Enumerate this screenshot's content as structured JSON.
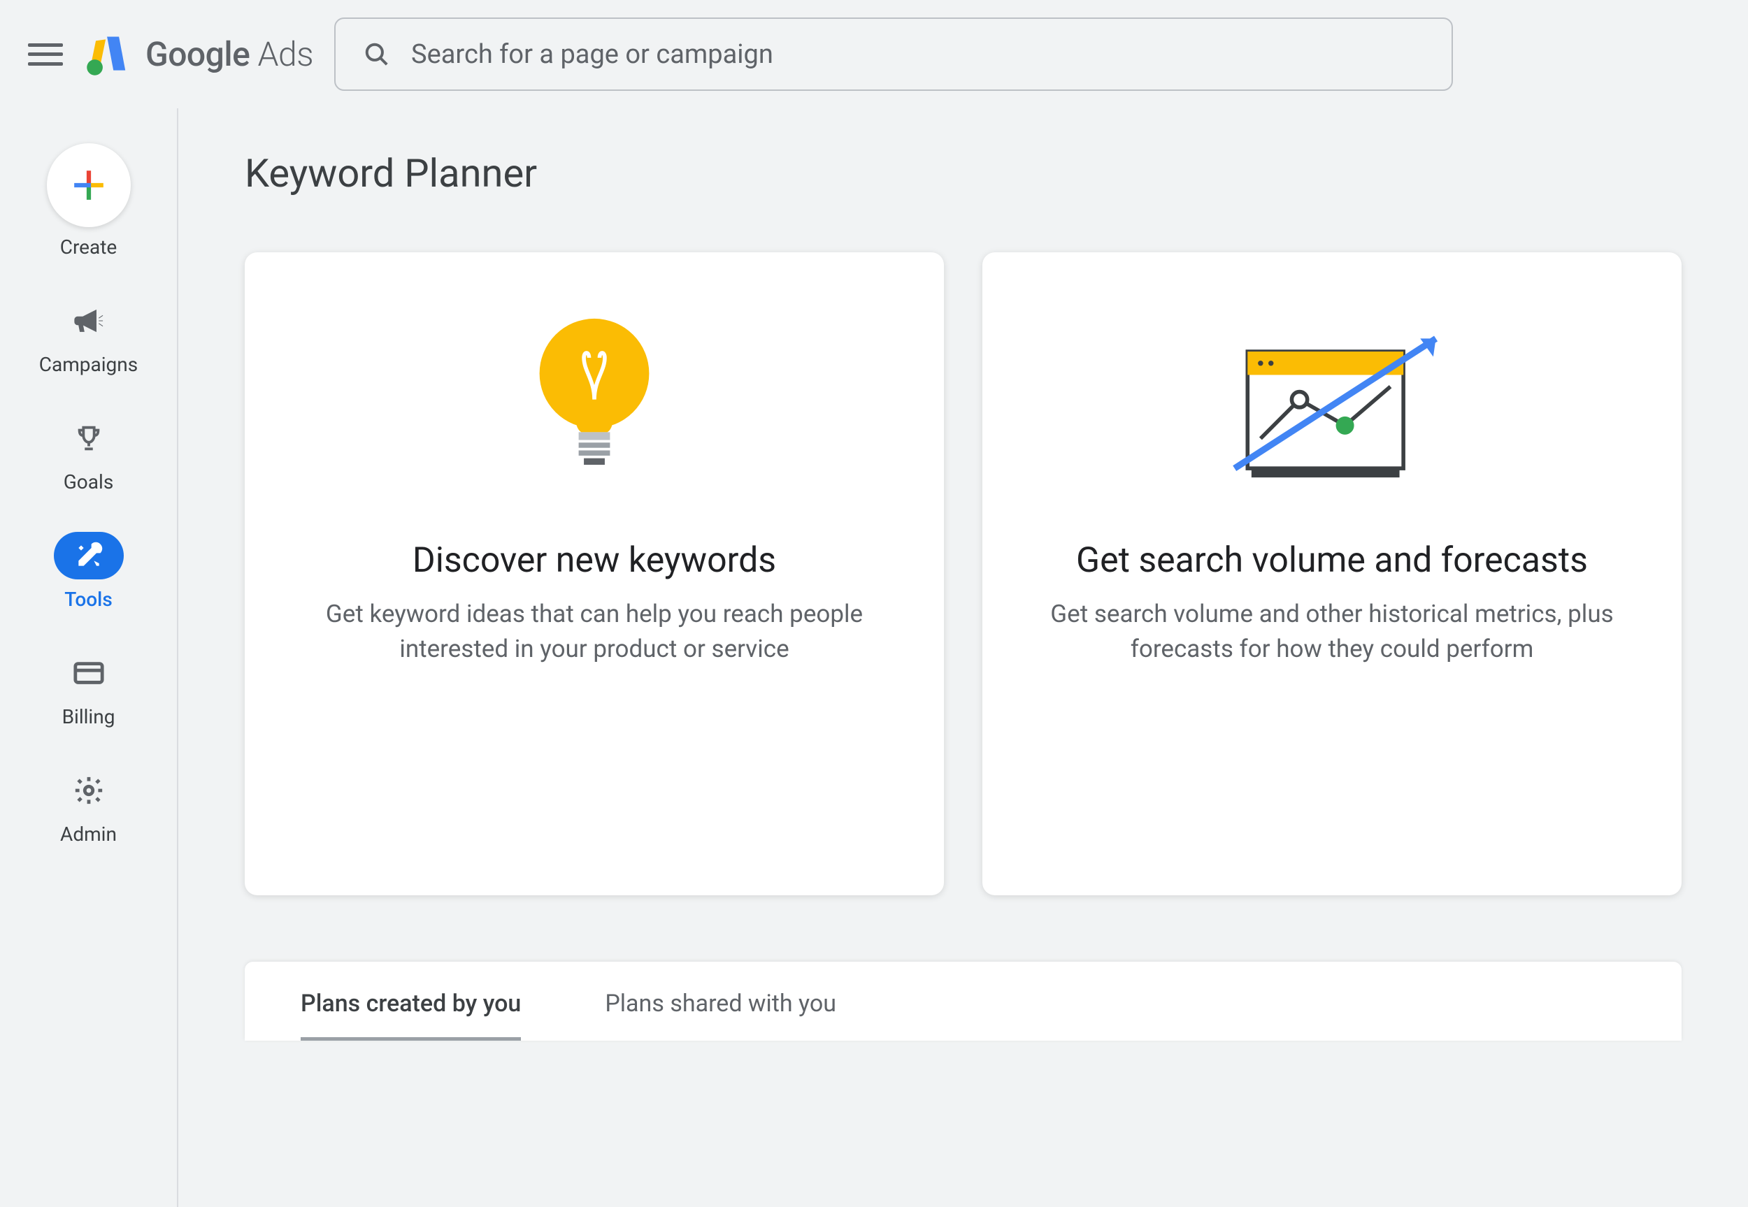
{
  "header": {
    "logo_text_bold": "Google",
    "logo_text_light": " Ads",
    "search_placeholder": "Search for a page or campaign"
  },
  "sidebar": {
    "items": [
      {
        "label": "Create",
        "icon": "plus-multicolor"
      },
      {
        "label": "Campaigns",
        "icon": "megaphone"
      },
      {
        "label": "Goals",
        "icon": "trophy"
      },
      {
        "label": "Tools",
        "icon": "wrench-screwdriver",
        "active": true
      },
      {
        "label": "Billing",
        "icon": "credit-card"
      },
      {
        "label": "Admin",
        "icon": "gear"
      }
    ]
  },
  "main": {
    "title": "Keyword Planner",
    "cards": [
      {
        "title": "Discover new keywords",
        "desc": "Get keyword ideas that can help you reach people interested in your product or service"
      },
      {
        "title": "Get search volume and forecasts",
        "desc": "Get search volume and other historical metrics, plus forecasts for how they could perform"
      }
    ],
    "tabs": [
      {
        "label": "Plans created by you",
        "active": true
      },
      {
        "label": "Plans shared with you",
        "active": false
      }
    ]
  },
  "colors": {
    "blue": "#1a73e8",
    "yellow": "#fbbc04",
    "green": "#34a853",
    "red": "#ea4335",
    "gray": "#5f6368"
  }
}
